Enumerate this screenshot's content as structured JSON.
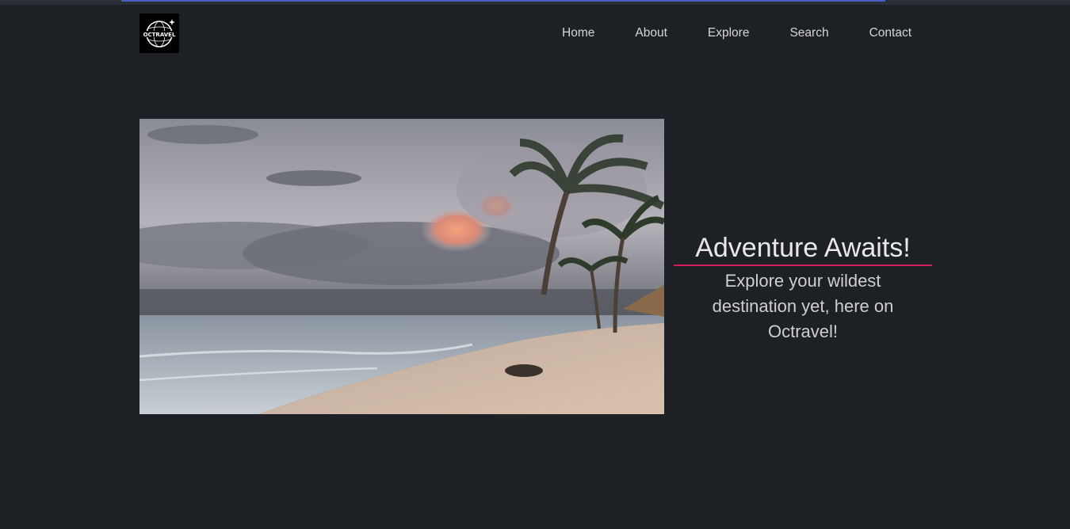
{
  "brand": {
    "logo_text": "OCTRAVEL"
  },
  "nav": {
    "items": [
      {
        "label": "Home"
      },
      {
        "label": "About"
      },
      {
        "label": "Explore"
      },
      {
        "label": "Search"
      },
      {
        "label": "Contact"
      }
    ]
  },
  "hero": {
    "title": "Adventure Awaits!",
    "subtitle": "Explore your wildest destination yet, here on Octravel!"
  },
  "colors": {
    "background": "#1d2024",
    "underline": "#d31c5b",
    "text": "#e8e8e8"
  }
}
